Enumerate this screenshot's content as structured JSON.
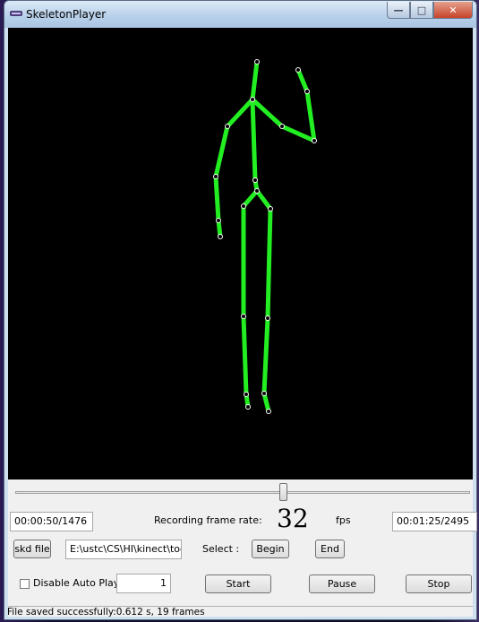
{
  "window": {
    "title": "SkeletonPlayer"
  },
  "controls": {
    "current_time": "00:00:50/1476",
    "recording_label": "Recording frame rate:",
    "frame_rate": "32",
    "fps_label": "fps",
    "total_time": "00:01:25/2495",
    "skd_button": "skd file",
    "file_path": "E:\\ustc\\CS\\HI\\kinect\\tools",
    "select_label": "Select :",
    "begin_button": "Begin",
    "end_button": "End",
    "disable_autoplay_label": "Disable Auto Play",
    "disable_autoplay_checked": false,
    "step_value": "1",
    "start_button": "Start",
    "pause_button": "Pause",
    "stop_button": "Stop"
  },
  "slider": {
    "position_fraction": 0.6
  },
  "status": {
    "text": "File  saved successfully:0.612 s, 19 frames"
  },
  "colors": {
    "skeleton": "#22ee22",
    "joint": "#ffffff",
    "canvas": "#000000"
  }
}
